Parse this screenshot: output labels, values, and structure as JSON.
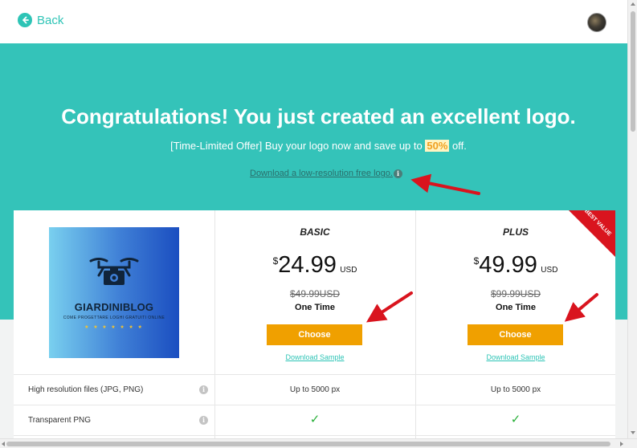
{
  "header": {
    "back_label": "Back",
    "back_icon": "arrow-left-circle-icon",
    "avatar_icon": "user-avatar"
  },
  "hero": {
    "title": "Congratulations! You just created an excellent logo.",
    "offer_before": "[Time-Limited Offer] Buy your logo now and save up to ",
    "offer_percent": "50%",
    "offer_after": " off.",
    "free_link": "Download a low-resolution free logo.",
    "info_icon": "i",
    "background_color": "#34c3b9"
  },
  "logo_preview": {
    "name": "GIARDINIBLOG",
    "tagline": "COME PROGETTARE LOGHI GRATUITI ONLINE",
    "stars": "★ ★ ★ ★ ★ ★ ★",
    "icon": "drone-camera-icon"
  },
  "plans": [
    {
      "name": "BASIC",
      "currency": "$",
      "price": "24.99",
      "unit": "USD",
      "old_price": "$49.99USD",
      "frequency": "One Time",
      "button": "Choose",
      "sample_link": "Download Sample"
    },
    {
      "name": "PLUS",
      "currency": "$",
      "price": "49.99",
      "unit": "USD",
      "old_price": "$99.99USD",
      "frequency": "One Time",
      "button": "Choose",
      "sample_link": "Download Sample",
      "ribbon": "BEST VALUE"
    }
  ],
  "features": [
    {
      "label": "High resolution files (JPG, PNG)",
      "basic": "Up to 5000 px",
      "plus": "Up to 5000 px"
    },
    {
      "label": "Transparent PNG",
      "basic": "✓",
      "plus": "✓"
    }
  ],
  "colors": {
    "accent": "#2ec4b6",
    "button": "#f0a000",
    "ribbon": "#d9141e",
    "annotation_arrow": "#d9141e",
    "check": "#2ab03a"
  }
}
